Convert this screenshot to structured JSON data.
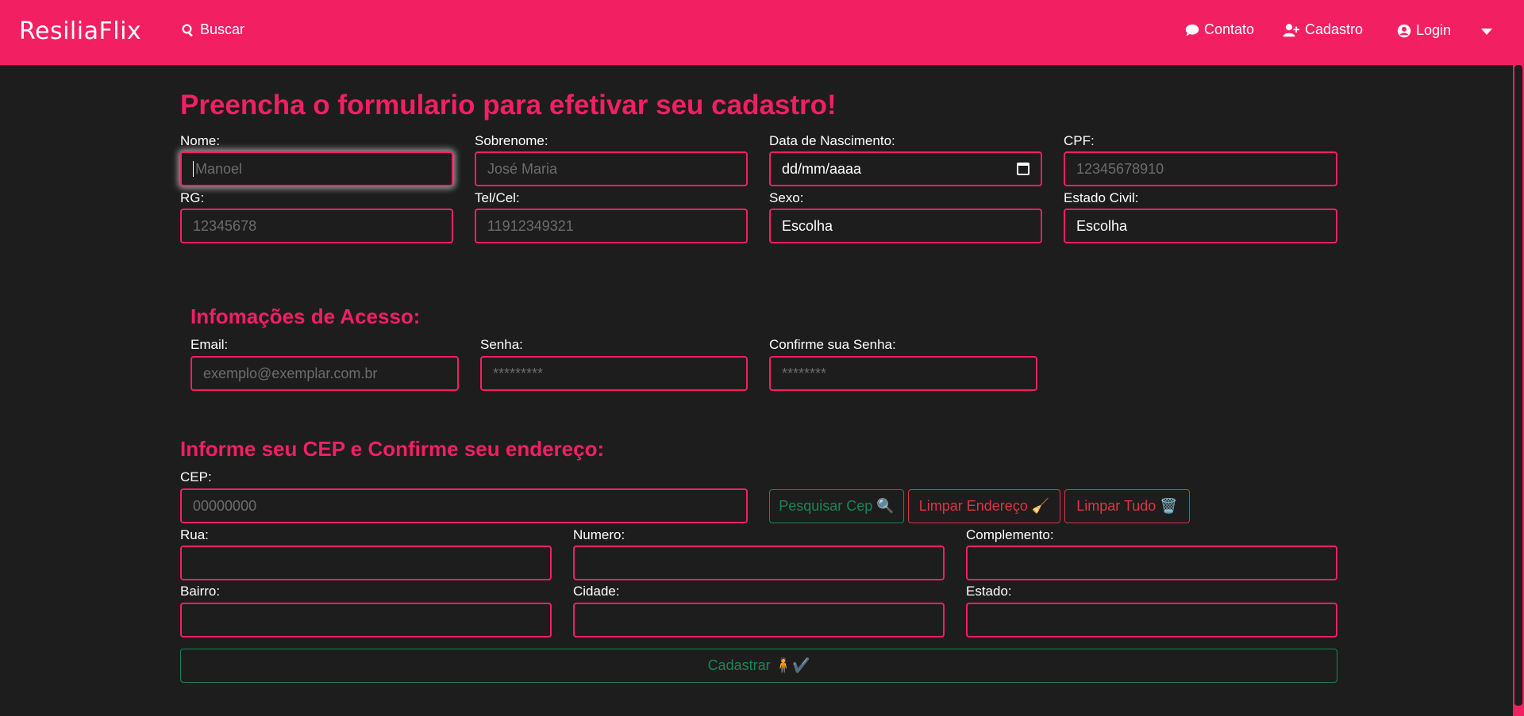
{
  "navbar": {
    "brand": "ResiliaFlix",
    "search": "Buscar",
    "contact": "Contato",
    "register": "Cadastro",
    "login": "Login"
  },
  "form": {
    "title": "Preencha o formulario para efetivar seu cadastro!",
    "personal": {
      "nome": {
        "label": "Nome:",
        "placeholder": "Manoel"
      },
      "sobrenome": {
        "label": "Sobrenome:",
        "placeholder": "José Maria"
      },
      "nascimento": {
        "label": "Data de Nascimento:",
        "value": "dd/mm/aaaa"
      },
      "cpf": {
        "label": "CPF:",
        "placeholder": "12345678910"
      },
      "rg": {
        "label": "RG:",
        "placeholder": "12345678"
      },
      "telcel": {
        "label": "Tel/Cel:",
        "placeholder": "11912349321"
      },
      "sexo": {
        "label": "Sexo:",
        "value": "Escolha"
      },
      "estado_civil": {
        "label": "Estado Civil:",
        "value": "Escolha"
      }
    },
    "access": {
      "title": "Infomações de Acesso:",
      "email": {
        "label": "Email:",
        "placeholder": "exemplo@exemplar.com.br"
      },
      "senha": {
        "label": "Senha:",
        "placeholder": "*********"
      },
      "confirme": {
        "label": "Confirme sua Senha:",
        "placeholder": "********"
      }
    },
    "address": {
      "title": "Informe seu CEP e Confirme seu endereço:",
      "cep": {
        "label": "CEP:",
        "placeholder": "00000000"
      },
      "pesquisar_btn": "Pesquisar Cep 🔍",
      "limpar_endereco_btn": "Limpar Endereço 🧹",
      "limpar_tudo_btn": "Limpar Tudo 🗑️",
      "rua": {
        "label": "Rua:",
        "value": ""
      },
      "numero": {
        "label": "Numero:",
        "value": ""
      },
      "complemento": {
        "label": "Complemento:",
        "value": ""
      },
      "bairro": {
        "label": "Bairro:",
        "value": ""
      },
      "cidade": {
        "label": "Cidade:",
        "value": ""
      },
      "estado": {
        "label": "Estado:",
        "value": ""
      }
    },
    "submit_btn": "Cadastrar 🧍✔️"
  },
  "colors": {
    "accent": "#f31f63",
    "background": "#1d1d1d",
    "success": "#198754",
    "danger": "#dc3545"
  }
}
